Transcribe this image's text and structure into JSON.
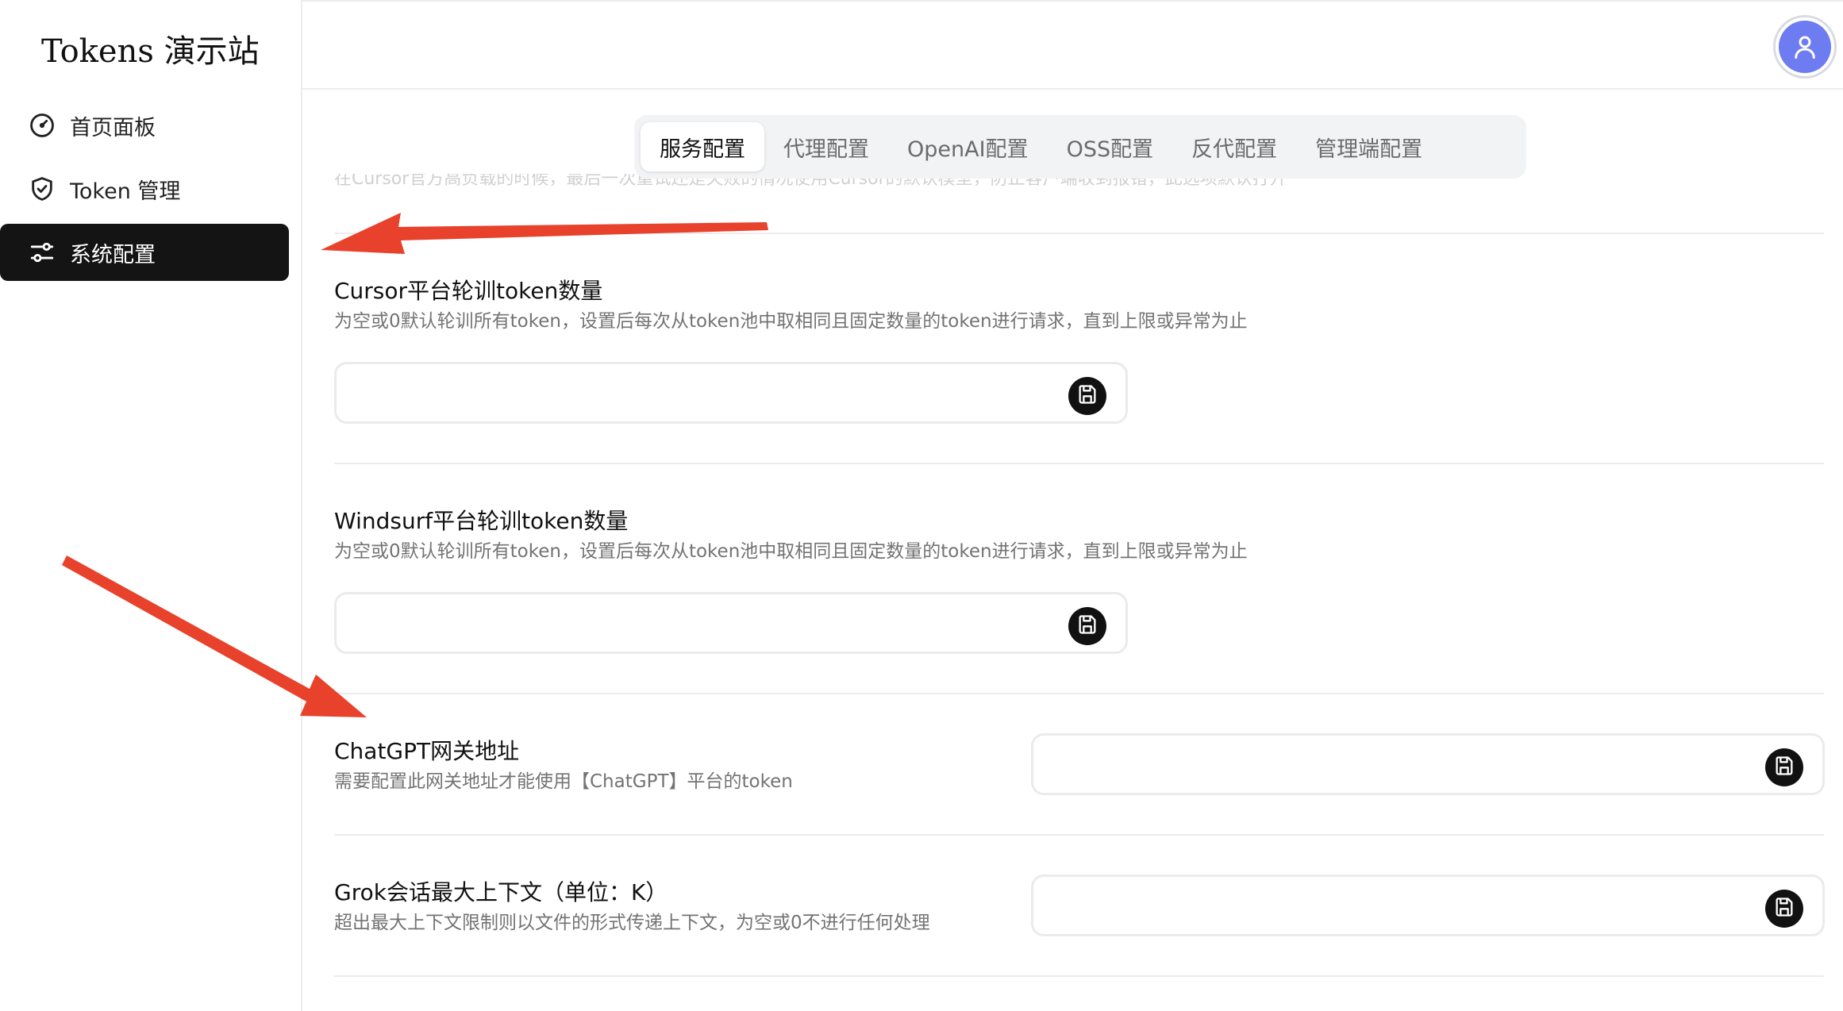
{
  "brand": "Tokens 演示站",
  "sidebar": {
    "items": [
      {
        "label": "首页面板",
        "icon": "gauge-icon",
        "active": false
      },
      {
        "label": "Token 管理",
        "icon": "shield-icon",
        "active": false
      },
      {
        "label": "系统配置",
        "icon": "sliders-icon",
        "active": true
      }
    ]
  },
  "header": {
    "avatar_icon": "user-icon",
    "avatar_color": "#6e7cf2"
  },
  "tabs": [
    {
      "label": "服务配置",
      "active": true
    },
    {
      "label": "代理配置",
      "active": false
    },
    {
      "label": "OpenAI配置",
      "active": false
    },
    {
      "label": "OSS配置",
      "active": false
    },
    {
      "label": "反代配置",
      "active": false
    },
    {
      "label": "管理端配置",
      "active": false
    }
  ],
  "ghost_text": "在Cursor官方高负载的时候，最后一次重试还是失败的情况使用Cursor的默认模型，防止客户端收到报错，此选项默认打开",
  "fields": [
    {
      "title": "Cursor平台轮训token数量",
      "desc": "为空或0默认轮训所有token，设置后每次从token池中取相同且固定数量的token进行请求，直到上限或异常为止",
      "value": ""
    },
    {
      "title": "Windsurf平台轮训token数量",
      "desc": "为空或0默认轮训所有token，设置后每次从token池中取相同且固定数量的token进行请求，直到上限或异常为止",
      "value": ""
    },
    {
      "title": "ChatGPT网关地址",
      "desc": "需要配置此网关地址才能使用【ChatGPT】平台的token",
      "value": ""
    },
    {
      "title": "Grok会话最大上下文（单位：K）",
      "desc": "超出最大上下文限制则以文件的形式传递上下文，为空或0不进行任何处理",
      "value": ""
    }
  ],
  "colors": {
    "accent": "#141414",
    "annotation_arrow": "#e8412c"
  }
}
